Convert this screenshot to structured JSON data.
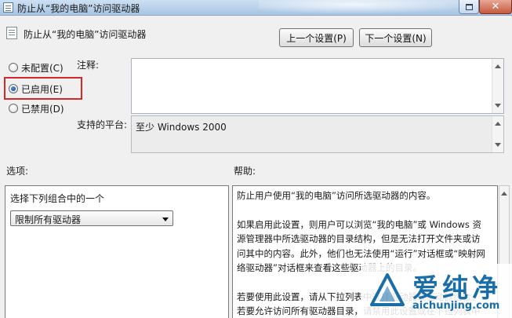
{
  "window": {
    "title": "防止从“我的电脑”访问驱动器"
  },
  "header": {
    "policy_title": "防止从“我的电脑”访问驱动器",
    "prev_button": "上一个设置(P)",
    "next_button": "下一个设置(N)"
  },
  "state": {
    "options": [
      {
        "label": "未配置(C)",
        "checked": false
      },
      {
        "label": "已启用(E)",
        "checked": true
      },
      {
        "label": "已禁用(D)",
        "checked": false
      }
    ]
  },
  "comment": {
    "label": "注释:",
    "value": ""
  },
  "platform": {
    "label": "支持的平台:",
    "value": "至少 Windows 2000"
  },
  "options_section": {
    "label": "选项:",
    "prompt": "选择下列组合中的一个",
    "dropdown_value": "限制所有驱动器"
  },
  "help_section": {
    "label": "帮助:",
    "paragraphs": [
      "防止用户使用“我的电脑”访问所选驱动器的内容。",
      "如果启用此设置，则用户可以浏览“我的电脑”或 Windows 资源管理器中所选驱动器的目录结构，但是无法打开文件夹或访问其中的内容。此外，他们也无法使用“运行”对话框或“映射网络驱动器”对话框来查看这些驱动器上的目录。",
      "若要使用此设置，请从下拉列表中选择驱动器或驱动器组合。若要允许访问所有驱动器目录，请禁用此设置或在下拉列表中选择“不限制驱动器”选项。"
    ]
  },
  "watermark": {
    "text_cn": "爱纯净",
    "text_en": "aichunjing.com"
  }
}
